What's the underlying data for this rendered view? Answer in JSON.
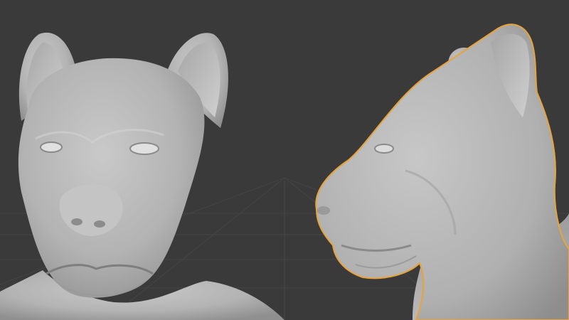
{
  "viewport": {
    "background_color": "#3a3a3a",
    "grid_color": "#4a4a4a",
    "selection_outline_color": "#e8a33a",
    "mesh_color": "#b8b8b8"
  },
  "objects": [
    {
      "name": "creature-head-front",
      "selected": false
    },
    {
      "name": "creature-head-side",
      "selected": true
    }
  ]
}
